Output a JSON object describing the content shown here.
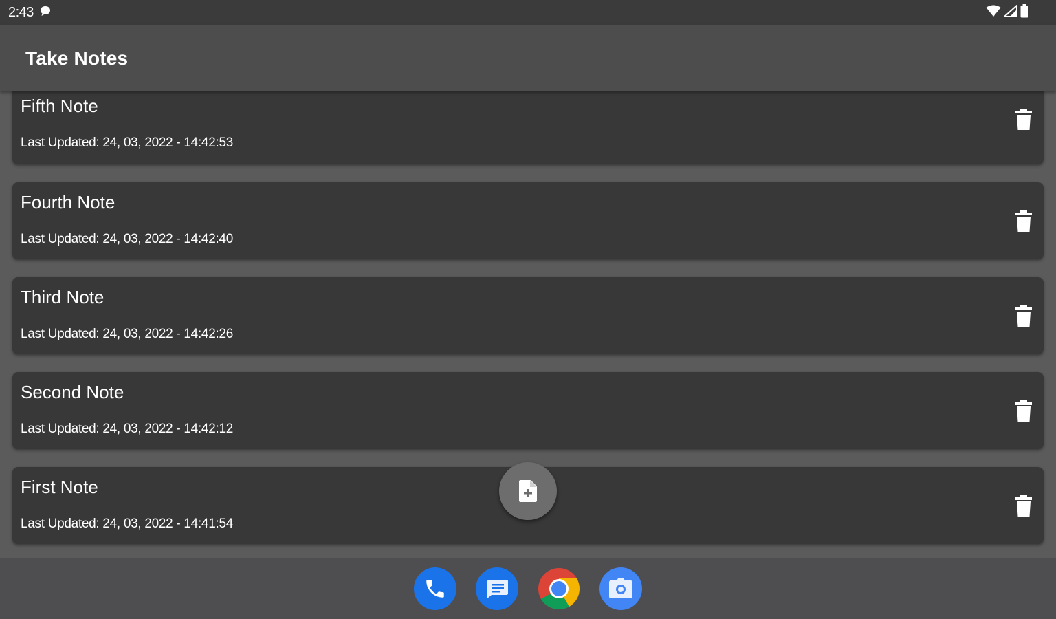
{
  "status_bar": {
    "time": "2:43"
  },
  "app_bar": {
    "title": "Take Notes"
  },
  "notes": [
    {
      "title": "Fifth Note",
      "updated": "Last Updated: 24, 03, 2022 - 14:42:53"
    },
    {
      "title": "Fourth Note",
      "updated": "Last Updated: 24, 03, 2022 - 14:42:40"
    },
    {
      "title": "Third Note",
      "updated": "Last Updated: 24, 03, 2022 - 14:42:26"
    },
    {
      "title": "Second Note",
      "updated": "Last Updated: 24, 03, 2022 - 14:42:12"
    },
    {
      "title": "First Note",
      "updated": "Last Updated: 24, 03, 2022 - 14:41:54"
    }
  ],
  "icons": {
    "delete": "trash-icon",
    "fab": "add-note-icon",
    "dock": [
      "phone-icon",
      "messages-icon",
      "chrome-icon",
      "camera-icon"
    ]
  },
  "colors": {
    "background": "#5b5b5b",
    "app_bar": "#4d4d4d",
    "card": "#383838",
    "fab": "#6d6d6d",
    "dock_blue": "#1a73e8"
  }
}
